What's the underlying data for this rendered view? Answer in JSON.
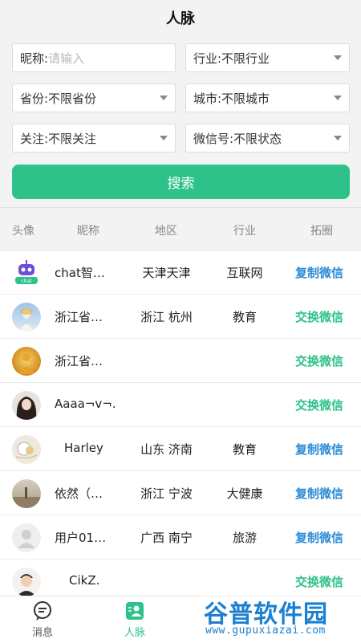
{
  "header": {
    "title": "人脉"
  },
  "filters": {
    "nickname_label": "昵称:",
    "nickname_placeholder": "请输入",
    "industry": "行业:不限行业",
    "province": "省份:不限省份",
    "city": "城市:不限城市",
    "follow": "关注:不限关注",
    "wechat": "微信号:不限状态"
  },
  "search_button": "搜索",
  "columns": [
    "头像",
    "昵称",
    "地区",
    "行业",
    "拓圈"
  ],
  "rows": [
    {
      "avatar": "chat-robot",
      "nickname": "chat智…",
      "region": "天津天津",
      "industry": "互联网",
      "action": "复制微信",
      "action_type": "copy"
    },
    {
      "avatar": "photo-statue",
      "nickname": "浙江省…",
      "region": "浙江 杭州",
      "industry": "教育",
      "action": "交换微信",
      "action_type": "swap"
    },
    {
      "avatar": "photo-buddha",
      "nickname": "浙江省…",
      "region": "",
      "industry": "",
      "action": "交换微信",
      "action_type": "swap"
    },
    {
      "avatar": "photo-woman",
      "nickname": "Aaaa¬v¬.",
      "region": "",
      "industry": "",
      "action": "交换微信",
      "action_type": "swap"
    },
    {
      "avatar": "photo-cartoon",
      "nickname": "Harley",
      "region": "山东 济南",
      "industry": "教育",
      "action": "复制微信",
      "action_type": "copy"
    },
    {
      "avatar": "photo-landscape",
      "nickname": "依然（…",
      "region": "浙江 宁波",
      "industry": "大健康",
      "action": "复制微信",
      "action_type": "copy"
    },
    {
      "avatar": "default-user",
      "nickname": "用户01…",
      "region": "广西 南宁",
      "industry": "旅游",
      "action": "复制微信",
      "action_type": "copy"
    },
    {
      "avatar": "photo-man",
      "nickname": "CikZ.",
      "region": "",
      "industry": "",
      "action": "交换微信",
      "action_type": "swap"
    }
  ],
  "tabs": [
    {
      "label": "消息",
      "icon": "message-icon",
      "active": false
    },
    {
      "label": "人脉",
      "icon": "contacts-icon",
      "active": true
    }
  ],
  "watermark": {
    "title": "谷普软件园",
    "url": "www.gupuxiazai.com"
  },
  "colors": {
    "accent": "#2ec28a",
    "copy": "#2a8ad6",
    "background": "#f3f3f3"
  }
}
